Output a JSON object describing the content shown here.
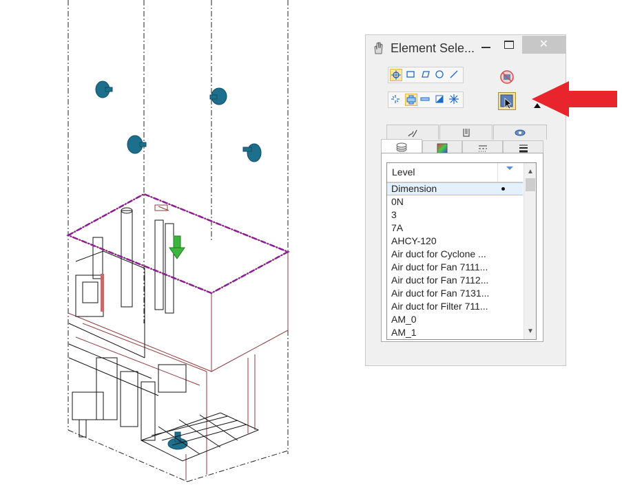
{
  "window": {
    "title": "Element Sele...",
    "minimize_glyph": "—",
    "close_glyph": "✕"
  },
  "toolbar": {
    "methods": [
      "individual-selector-icon",
      "block-selector-icon",
      "shape-selector-icon",
      "circle-selector-icon",
      "line-selector-icon"
    ],
    "modes": [
      "new-mode-icon",
      "add-mode-icon",
      "subtract-mode-icon",
      "invert-mode-icon",
      "clear-mode-icon"
    ],
    "selected_method": "individual-selector-icon",
    "selected_mode": "add-mode-icon"
  },
  "tabs_top": [
    "tab-sparkles",
    "tab-cells",
    "tab-eye"
  ],
  "tabs_bottom": [
    "tab-levels",
    "tab-color",
    "tab-line-style",
    "tab-line-weight"
  ],
  "active_tab": "tab-levels",
  "list": {
    "column_header": "Level",
    "items": [
      {
        "label": "Dimension",
        "selected": true,
        "marker": true
      },
      {
        "label": "0N"
      },
      {
        "label": "3"
      },
      {
        "label": "7A"
      },
      {
        "label": "AHCY-120"
      },
      {
        "label": "Air duct for Cyclone ..."
      },
      {
        "label": "Air duct for Fan 7111..."
      },
      {
        "label": "Air duct for Fan 7112..."
      },
      {
        "label": "Air duct for Fan 7131..."
      },
      {
        "label": "Air duct for Filter 711..."
      },
      {
        "label": "AM_0"
      },
      {
        "label": "AM_1"
      }
    ]
  },
  "colors": {
    "annotation_arrow": "#e8242c",
    "selection_highlight": "#e5f0fb",
    "cad_selection_outline": "#8a1a9a",
    "cad_handle": "#1d8aa8",
    "cad_green_handle": "#3db43d"
  }
}
